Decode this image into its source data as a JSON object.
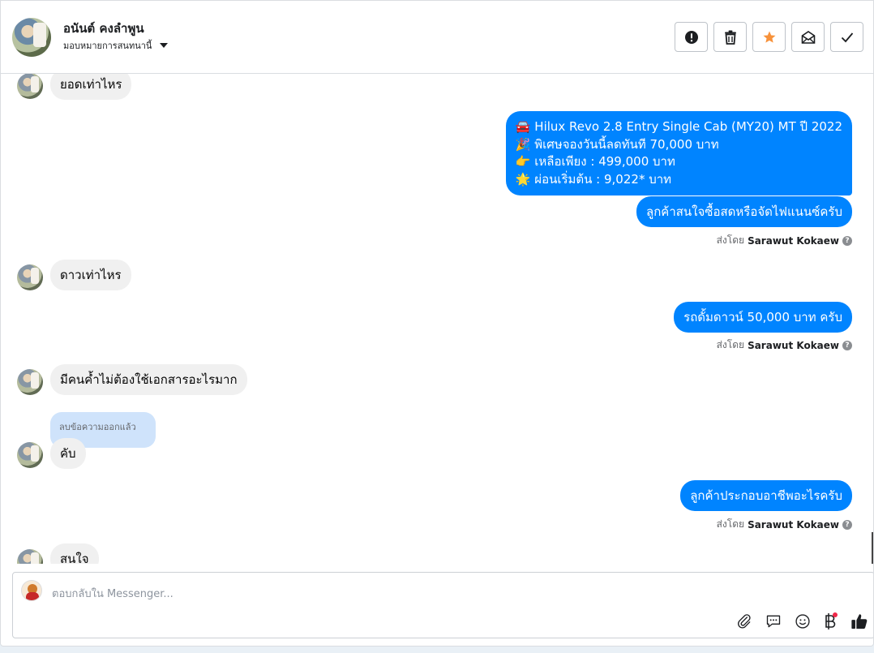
{
  "header": {
    "contact_name": "อนันต์ คงลำพูน",
    "assign_label": "มอบหมายการสนทนานี้"
  },
  "toolbar": {
    "buttons": [
      {
        "name": "report",
        "icon": "exclamation-icon"
      },
      {
        "name": "delete",
        "icon": "trash-icon"
      },
      {
        "name": "star",
        "icon": "star-icon",
        "color": "#f7923b"
      },
      {
        "name": "mark-unread",
        "icon": "envelope-icon"
      },
      {
        "name": "done",
        "icon": "check-icon"
      }
    ]
  },
  "messages": {
    "m1": "ยอดเท่าไหร",
    "m2_lines": [
      "🚘 Hilux Revo 2.8 Entry Single Cab (MY20) MT ปี 2022",
      "🎉 พิเศษจองวันนี้ลดทันที 70,000 บาท",
      "👉 เหลือเพียง : 499,000 บาท",
      "🌟 ผ่อนเริ่มต้น : 9,022* บาท"
    ],
    "m3": "ลูกค้าสนใจซื้อสดหรือจัดไฟแนนซ์ครับ",
    "m4": "ดาวเท่าไหร",
    "m5": "รถดั้มดาวน์ 50,000 บาท ครับ",
    "m6": "มีคนค้ำไม่ต้องใช้เอกสารอะไรมาก",
    "deleted": "ลบข้อความออกแล้ว",
    "m7": "คับ",
    "m8": "ลูกค้าประกอบอาชีพอะไรครับ",
    "m9": "สนใจ"
  },
  "sent_by": {
    "prefix": "ส่งโดย",
    "name": "Sarawut Kokaew"
  },
  "composer": {
    "placeholder": "ตอบกลับใน Messenger..."
  },
  "colors": {
    "outgoing_bubble": "#0084ff",
    "incoming_bubble": "#f0f0f0",
    "star": "#f7923b"
  }
}
